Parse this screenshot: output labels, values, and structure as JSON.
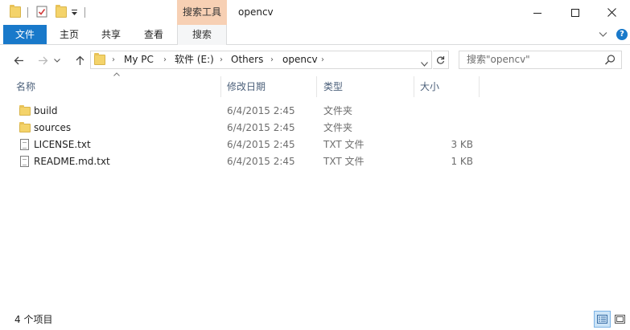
{
  "window": {
    "title": "opencv",
    "context_tab_group": "搜索工具",
    "minimize_icon": "minimize-icon",
    "maximize_icon": "maximize-icon",
    "close_icon": "close-icon"
  },
  "ribbon": {
    "tabs": [
      {
        "label": "文件"
      },
      {
        "label": "主页"
      },
      {
        "label": "共享"
      },
      {
        "label": "查看"
      },
      {
        "label": "搜索"
      }
    ],
    "help_label": "?"
  },
  "address_bar": {
    "crumbs": [
      "My PC",
      "软件 (E:)",
      "Others",
      "opencv"
    ]
  },
  "search": {
    "placeholder": "搜索\"opencv\""
  },
  "columns": {
    "name": "名称",
    "date": "修改日期",
    "type": "类型",
    "size": "大小"
  },
  "files": [
    {
      "name": "build",
      "date": "6/4/2015 2:45",
      "type": "文件夹",
      "size": "",
      "icon": "folder-icon"
    },
    {
      "name": "sources",
      "date": "6/4/2015 2:45",
      "type": "文件夹",
      "size": "",
      "icon": "folder-icon"
    },
    {
      "name": "LICENSE.txt",
      "date": "6/4/2015 2:45",
      "type": "TXT 文件",
      "size": "3 KB",
      "icon": "text-file-icon"
    },
    {
      "name": "README.md.txt",
      "date": "6/4/2015 2:45",
      "type": "TXT 文件",
      "size": "1 KB",
      "icon": "text-file-icon"
    }
  ],
  "status": {
    "item_count": "4 个项目"
  },
  "colors": {
    "file_tab": "#1979ca",
    "context_tab": "#f7d0b4",
    "column_header_text": "#4c607a"
  }
}
